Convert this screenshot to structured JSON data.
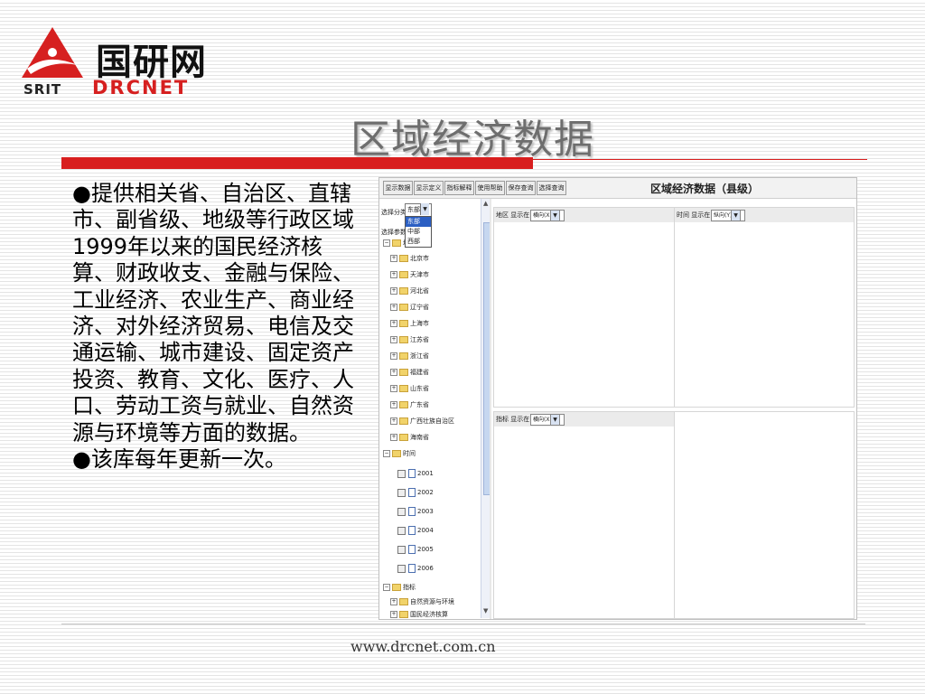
{
  "logo": {
    "cn": "国研网",
    "en": "DRCNET",
    "abbr": "SRIT",
    "colors": {
      "red": "#d62020",
      "dark": "#111111"
    }
  },
  "slide": {
    "title": "区域经济数据",
    "bullets": [
      "●提供相关省、自治区、直辖市、副省级、地级等行政区域1999年以来的国民经济核算、财政收支、金融与保险、工业经济、农业生产、商业经济、对外经济贸易、电信及交通运输、城市建设、固定资产投资、教育、文化、医疗、人口、劳动工资与就业、自然资源与环境等方面的数据。",
      "●该库每年更新一次。"
    ],
    "footer_url": "www.drcnet.com.cn",
    "accent": "#d81e1e"
  },
  "app": {
    "title": "区域经济数据（县级）",
    "toolbar": [
      "显示数据",
      "显示定义",
      "指标解释",
      "使用帮助",
      "保存查询",
      "选择查询"
    ],
    "dim_label": "选择分类：",
    "dim_selected": "东部",
    "dim_options": [
      "东部",
      "中部",
      "西部"
    ],
    "param_label": "选择参数",
    "tree_root": "地区",
    "regions": [
      "北京市",
      "天津市",
      "河北省",
      "辽宁省",
      "上海市",
      "江苏省",
      "浙江省",
      "福建省",
      "山东省",
      "广东省",
      "广西壮族自治区",
      "海南省"
    ],
    "time_node": "时间",
    "years": [
      "2001",
      "2002",
      "2003",
      "2004",
      "2005",
      "2006"
    ],
    "indicator_node": "指标",
    "indicators": [
      "自然资源与环境",
      "国民经济核算"
    ],
    "panels": {
      "region": {
        "label": "地区",
        "display_label": "显示在",
        "value": "横向(X)"
      },
      "time": {
        "label": "时间",
        "display_label": "显示在",
        "value": "纵向(Y)"
      },
      "indicator": {
        "label": "指标",
        "display_label": "显示在",
        "value": "横向(X)"
      }
    }
  }
}
